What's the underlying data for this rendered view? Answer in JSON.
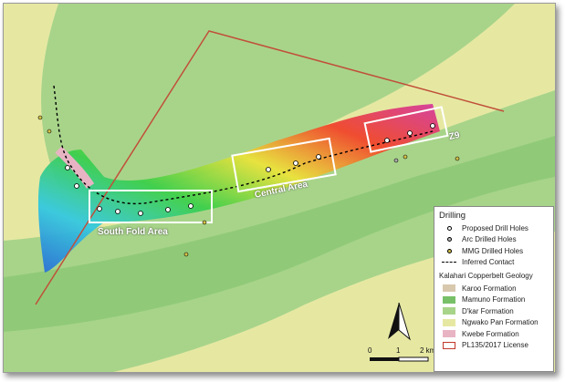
{
  "labels": {
    "south_fold": "South Fold Area",
    "central": "Central Area",
    "z9": "Z9"
  },
  "legend": {
    "title": "Drilling",
    "items": [
      {
        "label": "Proposed Drill Holes",
        "symbol": "white-dot"
      },
      {
        "label": "Arc Drilled Holes",
        "symbol": "grey-dot"
      },
      {
        "label": "MMG Drilled Holes",
        "symbol": "yellow-dot"
      },
      {
        "label": "Inferred Contact",
        "symbol": "dashed-line"
      }
    ],
    "geology_title": "Kalahari Copperbelt Geology",
    "geology": [
      {
        "label": "Karoo Formation",
        "color": "#d8c8ae"
      },
      {
        "label": "Mamuno Formation",
        "color": "#78c068"
      },
      {
        "label": "D'kar Formation",
        "color": "#a8d48a"
      },
      {
        "label": "Ngwako Pan Formation",
        "color": "#e6e8a2"
      },
      {
        "label": "Kwebe Formation",
        "color": "#e8b4c4"
      },
      {
        "label": "PL135/2017 License",
        "color": "#c0392b",
        "outline": true
      }
    ]
  },
  "scale": {
    "ticks": [
      "0",
      "1",
      "2 km"
    ]
  },
  "north_arrow": "north-arrow",
  "colors": {
    "background": "#e6e8a2",
    "band": "#a8d48a",
    "license": "#c0503a"
  }
}
